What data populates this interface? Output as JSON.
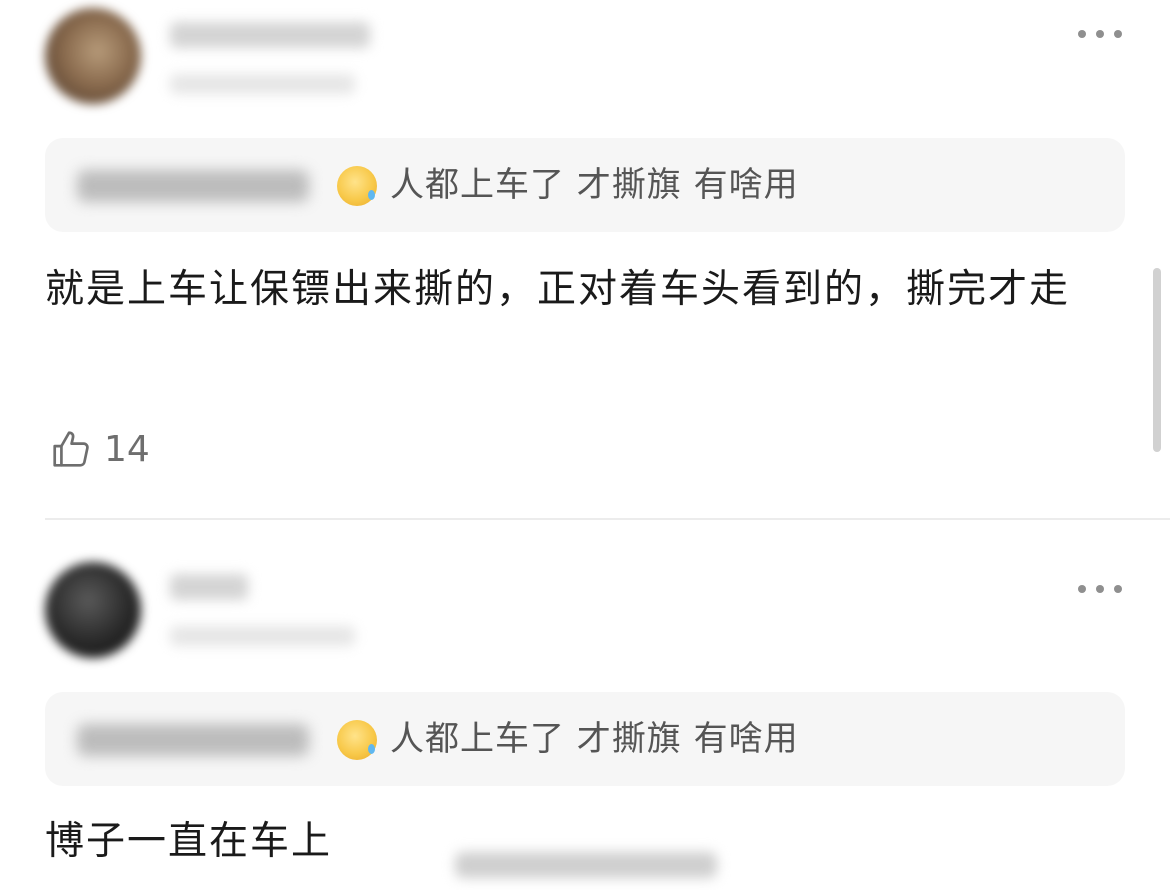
{
  "comments": [
    {
      "quote": {
        "text": "人都上车了 才撕旗 有啥用",
        "emoji": "crying-laughing-emoji"
      },
      "body": "就是上车让保镖出来撕的，正对着车头看到的，撕完才走",
      "likes": "14"
    },
    {
      "quote": {
        "text": "人都上车了 才撕旗 有啥用",
        "emoji": "crying-laughing-emoji"
      },
      "body": "博子一直在车上"
    }
  ],
  "icons": {
    "more": "more-horizontal-icon",
    "like": "thumbs-up-icon"
  },
  "colors": {
    "quote_background": "#f6f6f6",
    "secondary_text": "#555555",
    "dots": "#8f8f8f"
  }
}
